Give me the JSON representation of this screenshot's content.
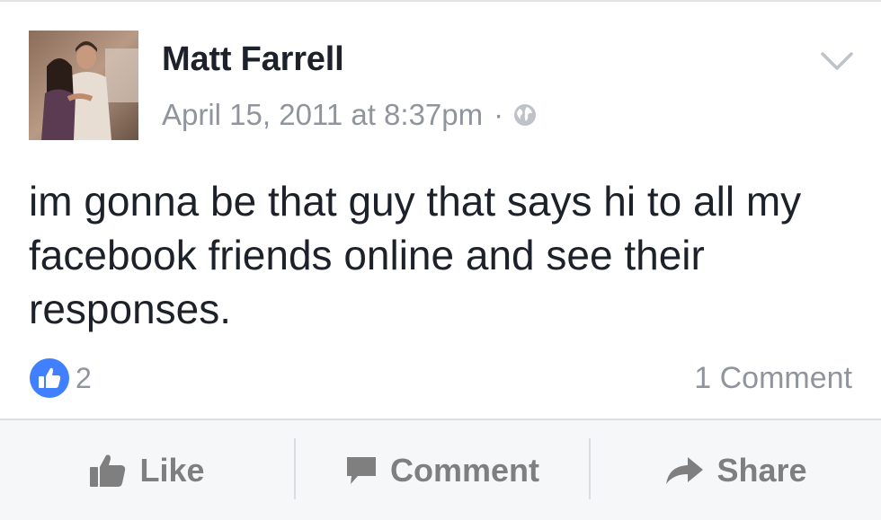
{
  "post": {
    "author": "Matt Farrell",
    "timestamp": "April 15, 2011 at 8:37pm",
    "separator": "·",
    "privacy_icon": "globe-icon",
    "text": "im gonna be that guy that says hi to all my facebook friends online and see their responses.",
    "like_count": "2",
    "comment_count_label": "1 Comment"
  },
  "actions": {
    "like_label": "Like",
    "comment_label": "Comment",
    "share_label": "Share"
  },
  "colors": {
    "primary_text": "#1d2129",
    "secondary_text": "#90949c",
    "like_badge": "#4080ff",
    "action_text": "#7f7f7f",
    "action_bar_bg": "#f6f7f9"
  }
}
